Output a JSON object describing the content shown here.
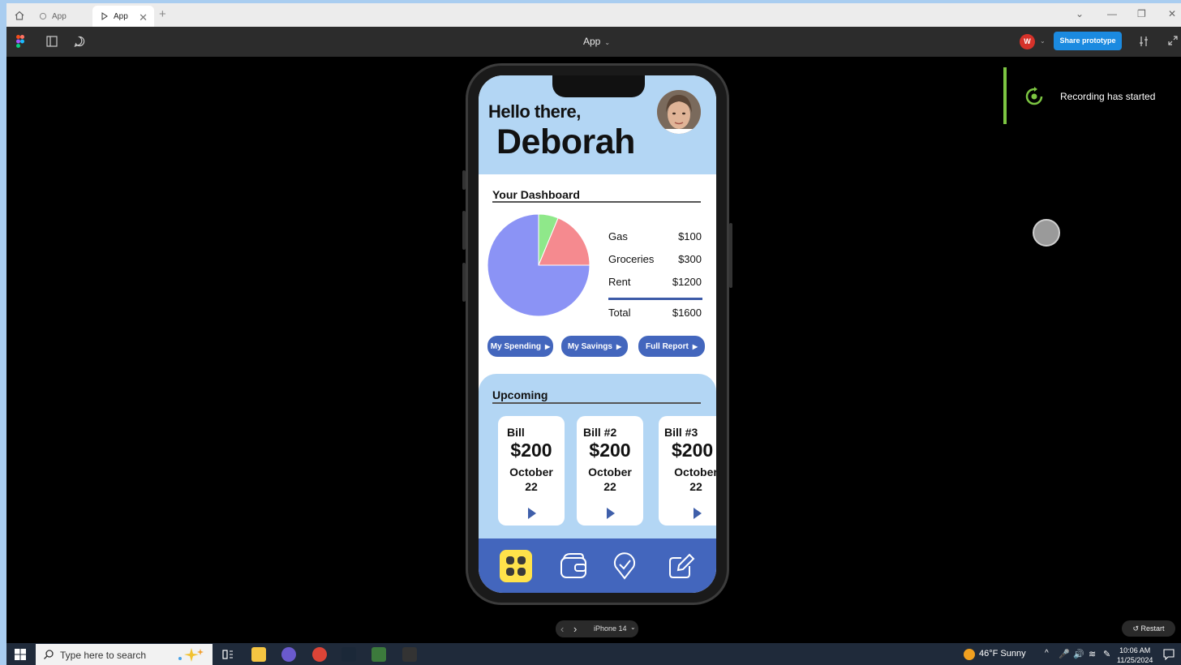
{
  "browser": {
    "tab1_label": "App",
    "tab2_label": "App",
    "close": "✕",
    "new_tab": "+",
    "chevron": "⌄",
    "minimize": "—",
    "restore": "❐",
    "window_close": "✕"
  },
  "toolbar": {
    "title": "App",
    "title_caret": "⌄",
    "user_initial": "W",
    "user_caret": "⌄",
    "share_label": "Share prototype"
  },
  "toast": {
    "text": "Recording has started",
    "accent": "#7cc542"
  },
  "app": {
    "greeting": "Hello there,",
    "name": "Deborah",
    "dashboard_title": "Your Dashboard",
    "expenses": [
      {
        "label": "Gas",
        "value": "$100",
        "amount": 100,
        "color": "#8fe88a"
      },
      {
        "label": "Groceries",
        "value": "$300",
        "amount": 300,
        "color": "#f58a8f"
      },
      {
        "label": "Rent",
        "value": "$1200",
        "amount": 1200,
        "color": "#8b93f5"
      }
    ],
    "total_label": "Total",
    "total_value": "$1600",
    "buttons": {
      "spending": "My Spending",
      "savings": "My Savings",
      "report": "Full Report"
    },
    "play_glyph": "▶",
    "upcoming_title": "Upcoming",
    "bills": [
      {
        "title": "Bill",
        "amount": "$200",
        "month": "October",
        "day": "22"
      },
      {
        "title": "Bill #2",
        "amount": "$200",
        "month": "October",
        "day": "22"
      },
      {
        "title": "Bill #3",
        "amount": "$200",
        "month": "October",
        "day": "22"
      }
    ],
    "nav_icons": [
      "grid-icon",
      "wallet-icon",
      "location-pin-icon",
      "edit-icon"
    ]
  },
  "preview": {
    "prev": "‹",
    "next": "›",
    "device": "iPhone 14",
    "device_caret": "⌄",
    "restart": "Restart"
  },
  "taskbar": {
    "search_placeholder": "Type here to search",
    "weather": "46°F  Sunny",
    "time": "10:06 AM",
    "date": "11/25/2024"
  }
}
